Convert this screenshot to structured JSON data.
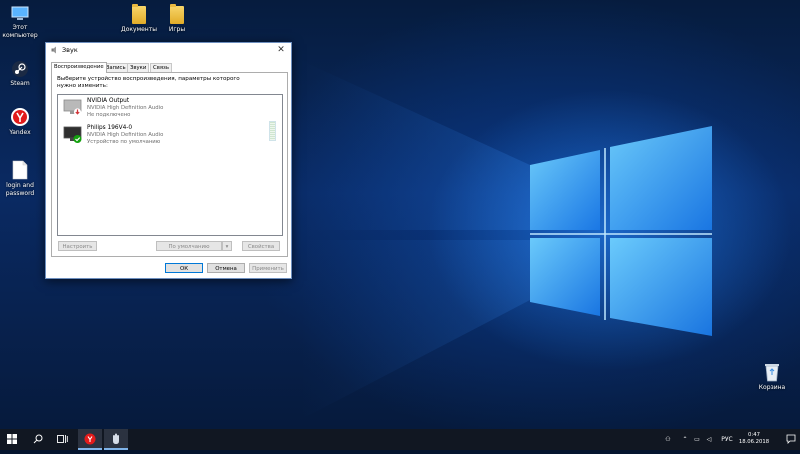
{
  "desktop": {
    "icons": [
      {
        "label": "Этот компьютер",
        "icon": "this-pc-icon"
      },
      {
        "label": "Steam",
        "icon": "steam-icon"
      },
      {
        "label": "Yandex",
        "icon": "yandex-icon"
      },
      {
        "label": "login and password",
        "icon": "text-file-icon"
      },
      {
        "label": "Документы",
        "icon": "folder-icon"
      },
      {
        "label": "Игры",
        "icon": "folder-icon"
      },
      {
        "label": "Корзина",
        "icon": "recycle-bin-icon"
      }
    ]
  },
  "dialog": {
    "title": "Звук",
    "tabs": [
      {
        "label": "Воспроизведение",
        "active": true
      },
      {
        "label": "Запись"
      },
      {
        "label": "Звуки"
      },
      {
        "label": "Связь"
      }
    ],
    "instruction": "Выберите устройство воспроизведения, параметры которого нужно изменить:",
    "devices": [
      {
        "name": "NVIDIA Output",
        "driver": "NVIDIA High Definition Audio",
        "status": "Не подключено"
      },
      {
        "name": "Philips 196V4-0",
        "driver": "NVIDIA High Definition Audio",
        "status": "Устройство по умолчанию"
      }
    ],
    "buttons": {
      "configure": "Настроить",
      "set_default": "По умолчанию",
      "properties": "Свойства",
      "ok": "ОК",
      "cancel": "Отмена",
      "apply": "Применить"
    }
  },
  "taskbar": {
    "language": "РУС",
    "time": "0:47",
    "date": "18.06.2018"
  },
  "colors": {
    "accent": "#0078d7",
    "taskbar": "#111722",
    "default_check": "#13a10e",
    "disconnected": "#d13438"
  }
}
